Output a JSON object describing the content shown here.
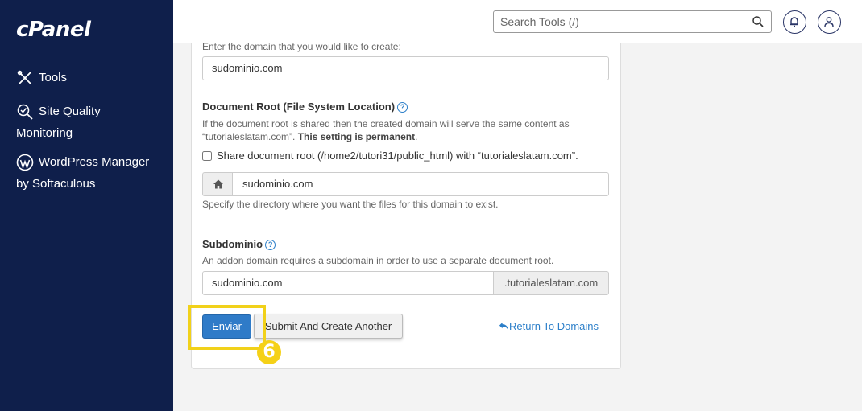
{
  "brand": {
    "logo_text": "cPanel"
  },
  "sidebar": {
    "items": [
      {
        "label_line1": "Tools",
        "label_line2": "",
        "icon": "tools-icon"
      },
      {
        "label_line1": "Site Quality",
        "label_line2": "Monitoring",
        "icon": "magnifier-check-icon"
      },
      {
        "label_line1": "WordPress Manager",
        "label_line2": "by Softaculous",
        "icon": "wordpress-icon"
      }
    ]
  },
  "topbar": {
    "search_placeholder": "Search Tools (/)",
    "notifications_icon": "bell-icon",
    "user_icon": "user-icon"
  },
  "form": {
    "domain_help": "Enter the domain that you would like to create:",
    "domain_value": "sudominio.com",
    "docroot_label": "Document Root (File System Location)",
    "docroot_desc_1": "If the document root is shared then the created domain will serve the same content as",
    "docroot_desc_2": "“tutorialeslatam.com”.",
    "docroot_desc_bold": "This setting is permanent",
    "docroot_desc_end": ".",
    "share_checkbox_label": "Share document root (/home2/tutori31/public_html) with “tutorialeslatam.com”.",
    "docroot_value": "sudominio.com",
    "docroot_hint": "Specify the directory where you want the files for this domain to exist.",
    "subdomain_label": "Subdominio",
    "subdomain_desc": "An addon domain requires a subdomain in order to use a separate document root.",
    "subdomain_value": "sudominio.com",
    "subdomain_suffix": ".tutorialeslatam.com",
    "submit_label": "Enviar",
    "submit_another_label": "Submit And Create Another",
    "return_label": "Return To Domains",
    "help_glyph": "?"
  },
  "annotation": {
    "step_number": "6",
    "highlight_color": "#f1d11a"
  },
  "colors": {
    "sidebar_bg": "#0f1f4b",
    "primary": "#2f7bc8",
    "link": "#2c7fc9"
  }
}
